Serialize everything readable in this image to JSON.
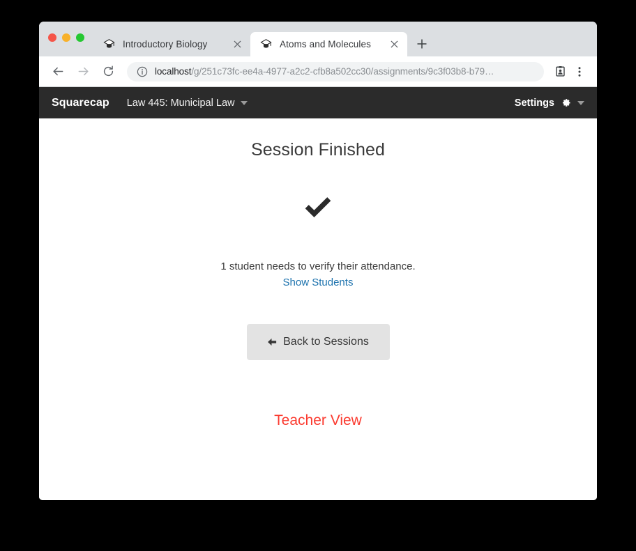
{
  "browser": {
    "traffic_lights": [
      "close",
      "minimize",
      "maximize"
    ],
    "tabs": [
      {
        "title": "Introductory Biology",
        "favicon": "graduation-cap-icon",
        "active": false,
        "close_label": "×"
      },
      {
        "title": "Atoms and Molecules",
        "favicon": "graduation-cap-icon",
        "active": true,
        "close_label": "×"
      }
    ],
    "new_tab_label": "+",
    "toolbar": {
      "back_label": "Back",
      "forward_label": "Forward",
      "reload_label": "Reload",
      "site_info_icon": "info-circle-icon",
      "url_host": "localhost",
      "url_path": "/g/251c73fc-ee4a-4977-a2c2-cfb8a502cc30/assignments/9c3f03b8-b79…",
      "badge_icon": "clipboard-icon",
      "menu_icon": "three-dots-vertical-icon"
    }
  },
  "app_header": {
    "brand": "Squarecap",
    "course": "Law 445: Municipal Law",
    "course_caret": "chevron-down-icon",
    "settings_label": "Settings",
    "settings_icon": "gear-icon",
    "settings_caret": "chevron-down-icon"
  },
  "main": {
    "title": "Session Finished",
    "status_icon": "checkmark-icon",
    "status_text": "1 student needs to verify their attendance.",
    "show_students_link": "Show Students",
    "back_button": "Back to Sessions",
    "back_button_icon": "arrow-left-icon",
    "teacher_view_link": "Teacher View"
  },
  "colors": {
    "header_bg": "#2b2b2b",
    "link_blue": "#1e73ae",
    "teacher_view_red": "#fb3b30",
    "button_gray": "#e3e3e3",
    "tabstrip_gray": "#dcdfe2"
  }
}
